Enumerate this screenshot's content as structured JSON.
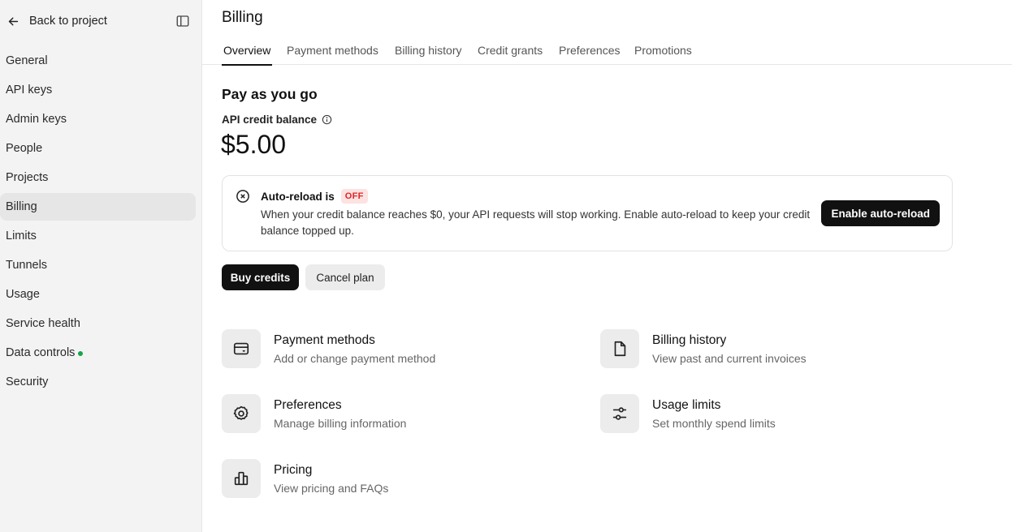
{
  "sidebar": {
    "back_label": "Back to project",
    "items": [
      {
        "label": "General"
      },
      {
        "label": "API keys"
      },
      {
        "label": "Admin keys"
      },
      {
        "label": "People"
      },
      {
        "label": "Projects"
      },
      {
        "label": "Billing"
      },
      {
        "label": "Limits"
      },
      {
        "label": "Tunnels"
      },
      {
        "label": "Usage"
      },
      {
        "label": "Service health"
      },
      {
        "label": "Data controls"
      },
      {
        "label": "Security"
      }
    ],
    "active_item": "Billing"
  },
  "header": {
    "title": "Billing",
    "tabs": [
      {
        "label": "Overview"
      },
      {
        "label": "Payment methods"
      },
      {
        "label": "Billing history"
      },
      {
        "label": "Credit grants"
      },
      {
        "label": "Preferences"
      },
      {
        "label": "Promotions"
      }
    ],
    "active_tab": "Overview"
  },
  "main": {
    "section_title": "Pay as you go",
    "balance_label": "API credit balance",
    "balance_value": "$5.00",
    "auto_reload": {
      "title": "Auto-reload is",
      "status": "OFF",
      "description": "When your credit balance reaches $0, your API requests will stop working. Enable auto-reload to keep your credit balance topped up.",
      "button_label": "Enable auto-reload"
    },
    "buy_credits_label": "Buy credits",
    "cancel_plan_label": "Cancel plan",
    "cards": [
      {
        "title": "Payment methods",
        "subtitle": "Add or change payment method",
        "icon": "credit-card-icon"
      },
      {
        "title": "Billing history",
        "subtitle": "View past and current invoices",
        "icon": "document-icon"
      },
      {
        "title": "Preferences",
        "subtitle": "Manage billing information",
        "icon": "gear-icon"
      },
      {
        "title": "Usage limits",
        "subtitle": "Set monthly spend limits",
        "icon": "sliders-icon"
      },
      {
        "title": "Pricing",
        "subtitle": "View pricing and FAQs",
        "icon": "bar-chart-icon"
      }
    ]
  },
  "colors": {
    "sidebar_bg": "#f3f3f3",
    "primary_button": "#111111",
    "off_badge_text": "#dc2626",
    "off_badge_bg": "#fde2e2",
    "status_dot": "#16a34a"
  }
}
